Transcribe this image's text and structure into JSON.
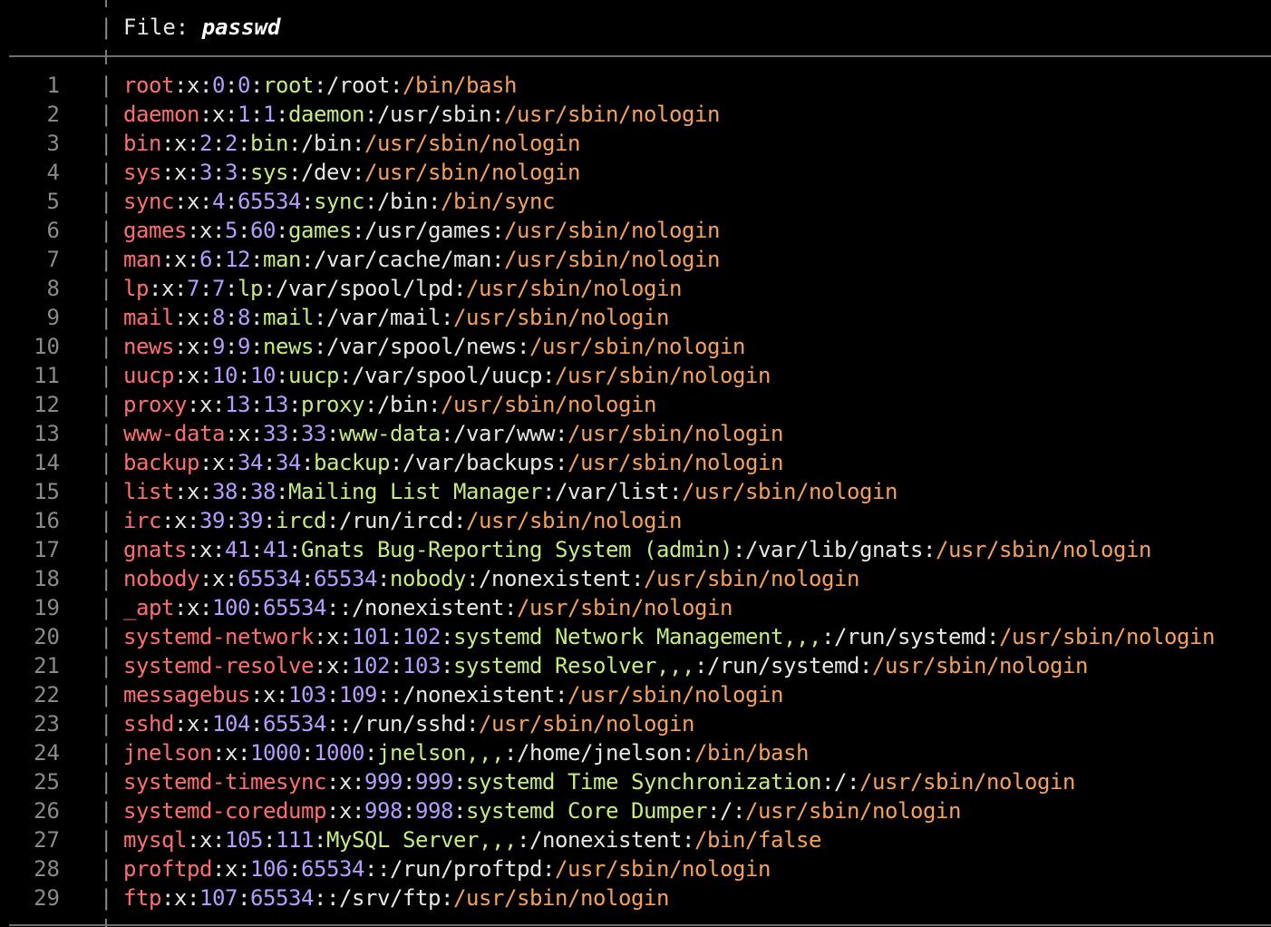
{
  "header": {
    "file_prefix": "File: ",
    "file_name": "passwd"
  },
  "colors": {
    "background": "#000000",
    "username": "#ff6e6e",
    "number": "#b89cff",
    "gecos": "#c5ec7d",
    "home": "#e6e6e6",
    "shell": "#f5a15a",
    "line_number": "#8a8a8a"
  },
  "lines": [
    {
      "n": "1",
      "user": "root",
      "pw": "x",
      "uid": "0",
      "gid": "0",
      "gecos": "root",
      "home": "/root",
      "shell": "/bin/bash"
    },
    {
      "n": "2",
      "user": "daemon",
      "pw": "x",
      "uid": "1",
      "gid": "1",
      "gecos": "daemon",
      "home": "/usr/sbin",
      "shell": "/usr/sbin/nologin"
    },
    {
      "n": "3",
      "user": "bin",
      "pw": "x",
      "uid": "2",
      "gid": "2",
      "gecos": "bin",
      "home": "/bin",
      "shell": "/usr/sbin/nologin"
    },
    {
      "n": "4",
      "user": "sys",
      "pw": "x",
      "uid": "3",
      "gid": "3",
      "gecos": "sys",
      "home": "/dev",
      "shell": "/usr/sbin/nologin"
    },
    {
      "n": "5",
      "user": "sync",
      "pw": "x",
      "uid": "4",
      "gid": "65534",
      "gecos": "sync",
      "home": "/bin",
      "shell": "/bin/sync"
    },
    {
      "n": "6",
      "user": "games",
      "pw": "x",
      "uid": "5",
      "gid": "60",
      "gecos": "games",
      "home": "/usr/games",
      "shell": "/usr/sbin/nologin"
    },
    {
      "n": "7",
      "user": "man",
      "pw": "x",
      "uid": "6",
      "gid": "12",
      "gecos": "man",
      "home": "/var/cache/man",
      "shell": "/usr/sbin/nologin"
    },
    {
      "n": "8",
      "user": "lp",
      "pw": "x",
      "uid": "7",
      "gid": "7",
      "gecos": "lp",
      "home": "/var/spool/lpd",
      "shell": "/usr/sbin/nologin"
    },
    {
      "n": "9",
      "user": "mail",
      "pw": "x",
      "uid": "8",
      "gid": "8",
      "gecos": "mail",
      "home": "/var/mail",
      "shell": "/usr/sbin/nologin"
    },
    {
      "n": "10",
      "user": "news",
      "pw": "x",
      "uid": "9",
      "gid": "9",
      "gecos": "news",
      "home": "/var/spool/news",
      "shell": "/usr/sbin/nologin"
    },
    {
      "n": "11",
      "user": "uucp",
      "pw": "x",
      "uid": "10",
      "gid": "10",
      "gecos": "uucp",
      "home": "/var/spool/uucp",
      "shell": "/usr/sbin/nologin"
    },
    {
      "n": "12",
      "user": "proxy",
      "pw": "x",
      "uid": "13",
      "gid": "13",
      "gecos": "proxy",
      "home": "/bin",
      "shell": "/usr/sbin/nologin"
    },
    {
      "n": "13",
      "user": "www-data",
      "pw": "x",
      "uid": "33",
      "gid": "33",
      "gecos": "www-data",
      "home": "/var/www",
      "shell": "/usr/sbin/nologin"
    },
    {
      "n": "14",
      "user": "backup",
      "pw": "x",
      "uid": "34",
      "gid": "34",
      "gecos": "backup",
      "home": "/var/backups",
      "shell": "/usr/sbin/nologin"
    },
    {
      "n": "15",
      "user": "list",
      "pw": "x",
      "uid": "38",
      "gid": "38",
      "gecos": "Mailing List Manager",
      "home": "/var/list",
      "shell": "/usr/sbin/nologin"
    },
    {
      "n": "16",
      "user": "irc",
      "pw": "x",
      "uid": "39",
      "gid": "39",
      "gecos": "ircd",
      "home": "/run/ircd",
      "shell": "/usr/sbin/nologin"
    },
    {
      "n": "17",
      "user": "gnats",
      "pw": "x",
      "uid": "41",
      "gid": "41",
      "gecos": "Gnats Bug-Reporting System (admin)",
      "home": "/var/lib/gnats",
      "shell": "/usr/sbin/nologin"
    },
    {
      "n": "18",
      "user": "nobody",
      "pw": "x",
      "uid": "65534",
      "gid": "65534",
      "gecos": "nobody",
      "home": "/nonexistent",
      "shell": "/usr/sbin/nologin"
    },
    {
      "n": "19",
      "user": "_apt",
      "pw": "x",
      "uid": "100",
      "gid": "65534",
      "gecos": "",
      "home": "/nonexistent",
      "shell": "/usr/sbin/nologin"
    },
    {
      "n": "20",
      "user": "systemd-network",
      "pw": "x",
      "uid": "101",
      "gid": "102",
      "gecos": "systemd Network Management,,,",
      "home": "/run/systemd",
      "shell": "/usr/sbin/nologin"
    },
    {
      "n": "21",
      "user": "systemd-resolve",
      "pw": "x",
      "uid": "102",
      "gid": "103",
      "gecos": "systemd Resolver,,,",
      "home": "/run/systemd",
      "shell": "/usr/sbin/nologin"
    },
    {
      "n": "22",
      "user": "messagebus",
      "pw": "x",
      "uid": "103",
      "gid": "109",
      "gecos": "",
      "home": "/nonexistent",
      "shell": "/usr/sbin/nologin"
    },
    {
      "n": "23",
      "user": "sshd",
      "pw": "x",
      "uid": "104",
      "gid": "65534",
      "gecos": "",
      "home": "/run/sshd",
      "shell": "/usr/sbin/nologin"
    },
    {
      "n": "24",
      "user": "jnelson",
      "pw": "x",
      "uid": "1000",
      "gid": "1000",
      "gecos": "jnelson,,,",
      "home": "/home/jnelson",
      "shell": "/bin/bash"
    },
    {
      "n": "25",
      "user": "systemd-timesync",
      "pw": "x",
      "uid": "999",
      "gid": "999",
      "gecos": "systemd Time Synchronization",
      "home": "/",
      "shell": "/usr/sbin/nologin"
    },
    {
      "n": "26",
      "user": "systemd-coredump",
      "pw": "x",
      "uid": "998",
      "gid": "998",
      "gecos": "systemd Core Dumper",
      "home": "/",
      "shell": "/usr/sbin/nologin"
    },
    {
      "n": "27",
      "user": "mysql",
      "pw": "x",
      "uid": "105",
      "gid": "111",
      "gecos": "MySQL Server,,,",
      "home": "/nonexistent",
      "shell": "/bin/false"
    },
    {
      "n": "28",
      "user": "proftpd",
      "pw": "x",
      "uid": "106",
      "gid": "65534",
      "gecos": "",
      "home": "/run/proftpd",
      "shell": "/usr/sbin/nologin"
    },
    {
      "n": "29",
      "user": "ftp",
      "pw": "x",
      "uid": "107",
      "gid": "65534",
      "gecos": "",
      "home": "/srv/ftp",
      "shell": "/usr/sbin/nologin"
    }
  ]
}
